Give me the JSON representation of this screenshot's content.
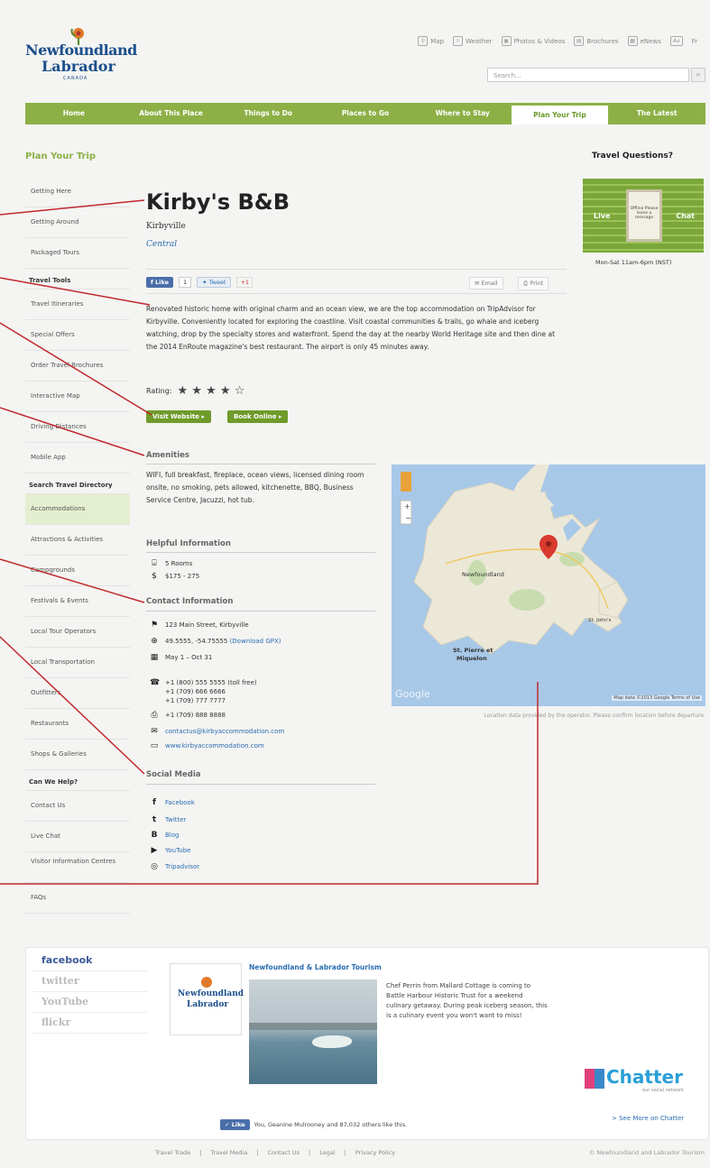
{
  "header": {
    "logo_line1": "Newfoundland",
    "logo_line2": "Labrador",
    "logo_line3": "CANADA",
    "toplinks": [
      "Map",
      "Weather",
      "Photos & Videos",
      "Brochures",
      "eNews",
      "Aa",
      "Fr"
    ],
    "search_placeholder": "Search..."
  },
  "nav": {
    "items": [
      "Home",
      "About This Place",
      "Things to Do",
      "Places to Go",
      "Where to Stay",
      "Plan Your Trip",
      "The Latest"
    ],
    "active": "Plan Your Trip"
  },
  "sidebar": {
    "title": "Plan Your Trip",
    "items": [
      {
        "type": "item",
        "label": "Getting Here"
      },
      {
        "type": "item",
        "label": "Getting Around"
      },
      {
        "type": "item",
        "label": "Packaged Tours"
      },
      {
        "type": "head",
        "label": "Travel Tools"
      },
      {
        "type": "item",
        "label": "Travel Itineraries"
      },
      {
        "type": "item",
        "label": "Special Offers"
      },
      {
        "type": "item",
        "label": "Order Travel Brochures"
      },
      {
        "type": "item",
        "label": "Interactive Map"
      },
      {
        "type": "item",
        "label": "Driving Distances"
      },
      {
        "type": "item",
        "label": "Mobile App"
      },
      {
        "type": "head",
        "label": "Search Travel Directory"
      },
      {
        "type": "item",
        "label": "Accommodations",
        "active": true
      },
      {
        "type": "item",
        "label": "Attractions & Activities"
      },
      {
        "type": "item",
        "label": "Campgrounds"
      },
      {
        "type": "item",
        "label": "Festivals & Events"
      },
      {
        "type": "item",
        "label": "Local Tour Operators"
      },
      {
        "type": "item",
        "label": "Local Transportation"
      },
      {
        "type": "item",
        "label": "Outfitters"
      },
      {
        "type": "item",
        "label": "Restaurants"
      },
      {
        "type": "item",
        "label": "Shops & Galleries"
      },
      {
        "type": "head",
        "label": "Can We Help?"
      },
      {
        "type": "item",
        "label": "Contact Us"
      },
      {
        "type": "item",
        "label": "Live Chat"
      },
      {
        "type": "item",
        "label": "Visitor Information Centres",
        "two": true
      },
      {
        "type": "item",
        "label": "FAQs"
      }
    ]
  },
  "right": {
    "title": "Travel Questions?",
    "live": "Live",
    "chat": "Chat",
    "sign_text": "Offline Please leave a message",
    "hours": "Mon-Sat 11am-6pm (NST)"
  },
  "listing": {
    "name": "Kirby's B&B",
    "city": "Kirbyville",
    "region": "Central",
    "like_label": "Like",
    "like_count": "1",
    "tweet_label": "Tweet",
    "gplus_label": "+1",
    "email_label": "Email",
    "print_label": "Print",
    "description": "Renovated historic home with original charm and an ocean view, we are the top accommodation on TripAdvisor for Kirbyville. Conveniently located for exploring the coastline. Visit coastal communities & trails, go whale and iceberg watching, drop by the specialty stores and waterfront. Spend the day at the nearby World Heritage site and then dine at the 2014 EnRoute magazine's best restaurant. The airport is only 45 minutes away.",
    "rating_label": "Rating:",
    "rating": 4,
    "rating_max": 5,
    "visit_btn": "Visit Website ▸",
    "book_btn": "Book Online ▸"
  },
  "amenities": {
    "heading": "Amenities",
    "text": "WIFI, full breakfast, fireplace, ocean views, licensed dining room onsite, no smoking, pets allowed, kitchenette, BBQ, Business Service Centre, Jacuzzi, hot tub."
  },
  "helpful": {
    "heading": "Helpful Information",
    "rooms": "5 Rooms",
    "price": "$175 - 275"
  },
  "contact": {
    "heading": "Contact Information",
    "address": "123 Main Street, Kirbyville",
    "coords": "49.5555, -54.75555",
    "gpx": "(Download GPX)",
    "season": "May 1 – Oct 31",
    "phone1": "+1 (800) 555 5555 (toll free)",
    "phone2": "+1 (709) 666 6666",
    "phone3": "+1 (709) 777 7777",
    "fax": "+1 (709) 888 8888",
    "email": "contactus@kirbyaccommodation.com",
    "web": "www.kirbyaccommodation.com"
  },
  "social": {
    "heading": "Social Media",
    "links": [
      "Facebook",
      "Twitter",
      "Blog",
      "YouTube",
      "Tripadvisor"
    ]
  },
  "map": {
    "label_nf": "Newfoundland",
    "label_sp1": "St. Pierre et",
    "label_sp2": "Miquelon",
    "label_stjohns": "St. John's",
    "google": "Google",
    "attribution": "Map data ©2013 Google   Terms of Use",
    "caption": "Location data provided by the operator. Please confirm location before departure."
  },
  "footer": {
    "tabs": [
      "facebook",
      "twitter",
      "YouTube",
      "flickr"
    ],
    "logo_a": "Newfoundland",
    "logo_b": "Labrador",
    "post_title": "Newfoundland & Labrador Tourism",
    "post_text": "Chef Perrin from Mallard Cottage is coming to Battle Harbour Historic Trust for a weekend culinary getaway. During peak iceberg season, this is a culinary event you won't want to miss!",
    "like_btn": "Like",
    "like_text": "You, Geanine Mulrooney and 87,032 others like this.",
    "chatter": "Chatter",
    "chatter_sub": "our social network",
    "see_more": "> See More on Chatter",
    "bottom_links": [
      "Travel Trade",
      "Travel Media",
      "Contact Us",
      "Legal",
      "Privacy Policy"
    ],
    "copyright": "© Newfoundland and Labrador Tourism"
  },
  "colors": {
    "nav_green": "#8db046",
    "button_green": "#6e9b2a",
    "link_blue": "#2a6db0",
    "annotation_red": "#c0282d",
    "map_water": "#a8c8e8",
    "map_land": "#ece8d8"
  }
}
